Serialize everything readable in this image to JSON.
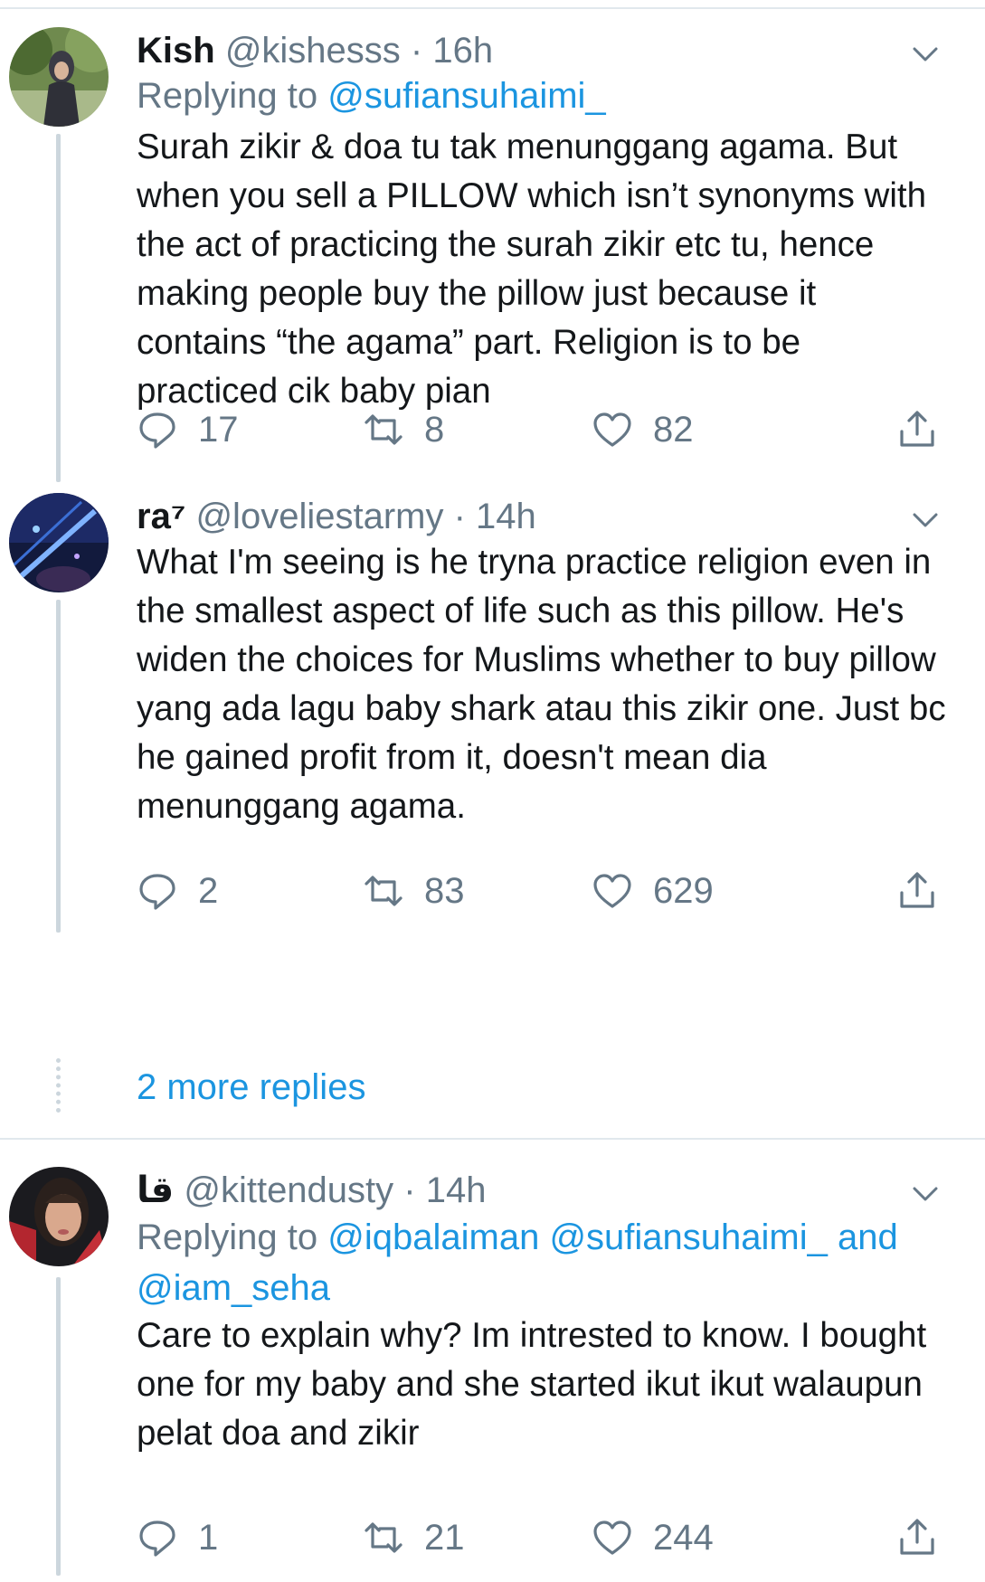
{
  "tweets": [
    {
      "name": "Kish",
      "handle": "@kishesss",
      "time": "16h",
      "replying_prefix": "Replying to",
      "replying_to": "@sufiansuhaimi_",
      "text": "Surah zikir & doa tu tak menunggang agama. But when you sell a PILLOW which isn’t synonyms with the act of practicing the surah zikir etc tu, hence making people buy the pillow just because it contains “the agama” part. Religion is to be practiced cik baby pian",
      "replies": "17",
      "retweets": "8",
      "likes": "82"
    },
    {
      "name": "ra⁷",
      "handle": "@loveliestarmy",
      "time": "14h",
      "text": "What I'm seeing is he tryna practice religion even in the smallest aspect of life such as this pillow. He's widen the choices for Muslims whether to buy pillow yang ada lagu baby shark atau this zikir one. Just bc he gained profit from it, doesn't mean dia menunggang agama.",
      "replies": "2",
      "retweets": "83",
      "likes": "629"
    },
    {
      "name": "قا",
      "handle": "@kittendusty",
      "time": "14h",
      "replying_prefix": "Replying to",
      "replying_to_1": "@iqbalaiman",
      "replying_to_2": "@sufiansuhaimi_",
      "replying_and": "and",
      "replying_to_3": "@iam_seha",
      "text": "Care to explain why? Im intrested to know. I bought one for my baby and she started ikut ikut walaupun pelat doa and zikir",
      "replies": "1",
      "retweets": "21",
      "likes": "244"
    }
  ],
  "more_replies": "2 more replies",
  "separator": "·",
  "icons": {
    "reply": "reply-icon",
    "retweet": "retweet-icon",
    "like": "heart-icon",
    "share": "share-icon",
    "menu": "chevron-down-icon"
  },
  "colors": {
    "link": "#1b95e0",
    "muted": "#657786",
    "text": "#14171a",
    "thread": "#ccd6dd"
  }
}
